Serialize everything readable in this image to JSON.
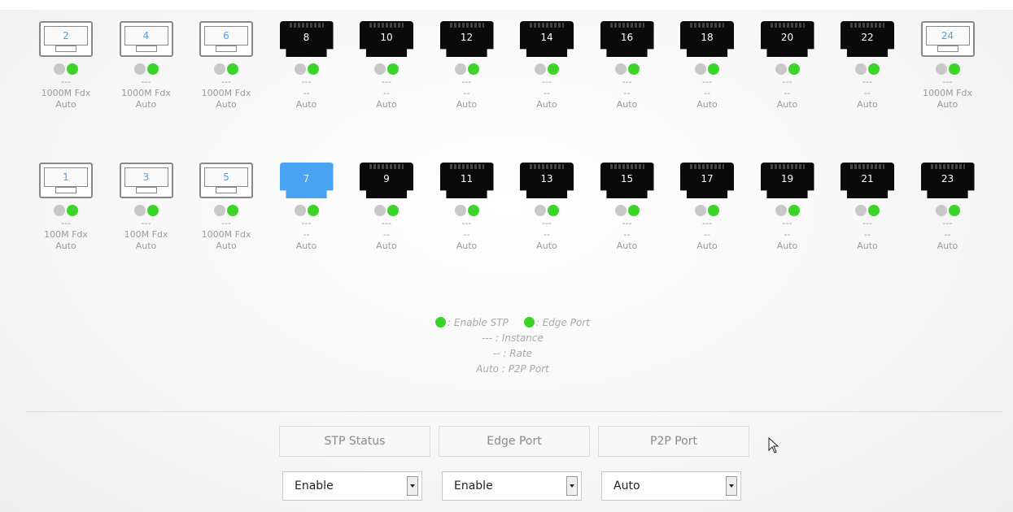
{
  "ports_top": [
    {
      "num": "2",
      "type": "sfp",
      "instance": "---",
      "speed": "1000M Fdx",
      "p2p": "Auto"
    },
    {
      "num": "4",
      "type": "sfp",
      "instance": "---",
      "speed": "1000M Fdx",
      "p2p": "Auto"
    },
    {
      "num": "6",
      "type": "sfp",
      "instance": "---",
      "speed": "1000M Fdx",
      "p2p": "Auto"
    },
    {
      "num": "8",
      "type": "rj45",
      "instance": "---",
      "speed": "--",
      "p2p": "Auto"
    },
    {
      "num": "10",
      "type": "rj45",
      "instance": "---",
      "speed": "--",
      "p2p": "Auto"
    },
    {
      "num": "12",
      "type": "rj45",
      "instance": "---",
      "speed": "--",
      "p2p": "Auto"
    },
    {
      "num": "14",
      "type": "rj45",
      "instance": "---",
      "speed": "--",
      "p2p": "Auto"
    },
    {
      "num": "16",
      "type": "rj45",
      "instance": "---",
      "speed": "--",
      "p2p": "Auto"
    },
    {
      "num": "18",
      "type": "rj45",
      "instance": "---",
      "speed": "--",
      "p2p": "Auto"
    },
    {
      "num": "20",
      "type": "rj45",
      "instance": "---",
      "speed": "--",
      "p2p": "Auto"
    },
    {
      "num": "22",
      "type": "rj45",
      "instance": "---",
      "speed": "--",
      "p2p": "Auto"
    },
    {
      "num": "24",
      "type": "sfp",
      "instance": "---",
      "speed": "1000M Fdx",
      "p2p": "Auto"
    }
  ],
  "ports_bottom": [
    {
      "num": "1",
      "type": "sfp",
      "instance": "---",
      "speed": "100M Fdx",
      "p2p": "Auto"
    },
    {
      "num": "3",
      "type": "sfp",
      "instance": "---",
      "speed": "100M Fdx",
      "p2p": "Auto"
    },
    {
      "num": "5",
      "type": "sfp",
      "instance": "---",
      "speed": "1000M Fdx",
      "p2p": "Auto"
    },
    {
      "num": "7",
      "type": "rj45",
      "selected": true,
      "instance": "---",
      "speed": "--",
      "p2p": "Auto"
    },
    {
      "num": "9",
      "type": "rj45",
      "instance": "---",
      "speed": "--",
      "p2p": "Auto"
    },
    {
      "num": "11",
      "type": "rj45",
      "instance": "---",
      "speed": "--",
      "p2p": "Auto"
    },
    {
      "num": "13",
      "type": "rj45",
      "instance": "---",
      "speed": "--",
      "p2p": "Auto"
    },
    {
      "num": "15",
      "type": "rj45",
      "instance": "---",
      "speed": "--",
      "p2p": "Auto"
    },
    {
      "num": "17",
      "type": "rj45",
      "instance": "---",
      "speed": "--",
      "p2p": "Auto"
    },
    {
      "num": "19",
      "type": "rj45",
      "instance": "---",
      "speed": "--",
      "p2p": "Auto"
    },
    {
      "num": "21",
      "type": "rj45",
      "instance": "---",
      "speed": "--",
      "p2p": "Auto"
    },
    {
      "num": "23",
      "type": "rj45",
      "instance": "---",
      "speed": "--",
      "p2p": "Auto"
    }
  ],
  "legend": {
    "enable_stp": ": Enable STP",
    "edge_port": ": Edge Port",
    "instance": "--- : Instance",
    "rate": "-- : Rate",
    "p2p": "Auto : P2P Port"
  },
  "controls": {
    "stp_status_label": "STP Status",
    "edge_port_label": "Edge Port",
    "p2p_port_label": "P2P Port",
    "stp_status_value": "Enable",
    "edge_port_value": "Enable",
    "p2p_port_value": "Auto"
  },
  "colors": {
    "led_green": "#3dd42a",
    "led_gray": "#c8c8c8",
    "selected_port": "#4aa3f0",
    "sfp_number": "#4aa3f0"
  },
  "icons": {
    "rj45": "ethernet-port-icon",
    "sfp": "sfp-port-icon",
    "cursor": "mouse-pointer-icon"
  }
}
